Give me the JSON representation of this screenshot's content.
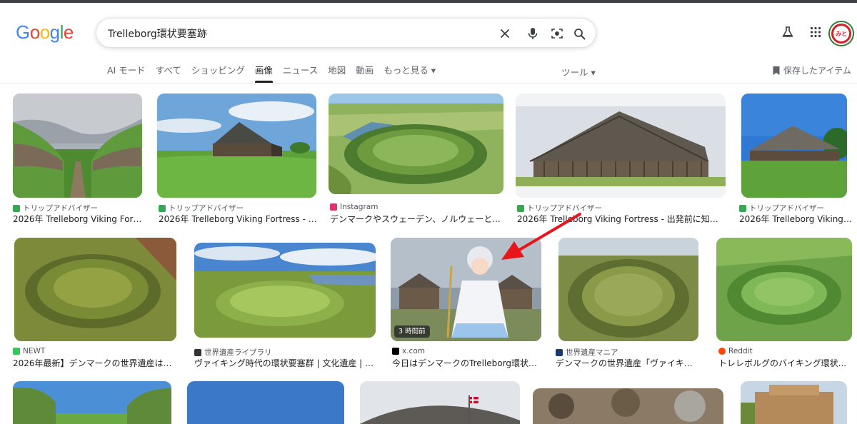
{
  "search": {
    "query": "Trelleborg環状要塞跡"
  },
  "logo": [
    "G",
    "o",
    "o",
    "g",
    "l",
    "e"
  ],
  "logo_colors": [
    "#4285F4",
    "#EA4335",
    "#FBBC05",
    "#4285F4",
    "#34A853",
    "#EA4335"
  ],
  "icons": {
    "clear": "close-icon",
    "voice": "microphone-icon",
    "lens": "camera-lens-icon",
    "search": "search-icon",
    "labs": "flask-icon",
    "apps": "apps-grid-icon",
    "saved": "bookmark-icon"
  },
  "avatar": {
    "text": "みと"
  },
  "tabs": [
    {
      "label": "AI モード",
      "active": false
    },
    {
      "label": "すべて",
      "active": false
    },
    {
      "label": "ショッピング",
      "active": false
    },
    {
      "label": "画像",
      "active": true
    },
    {
      "label": "ニュース",
      "active": false
    },
    {
      "label": "地図",
      "active": false
    },
    {
      "label": "動画",
      "active": false
    },
    {
      "label": "もっと見る ▾",
      "active": false
    }
  ],
  "tools_label": "ツール ▾",
  "saved_label": "保存したアイテム",
  "results_row1": [
    {
      "source": "トリップアドバイザー",
      "title": "2026年 Trelleborg Viking Fortres...",
      "favicon": "#34a853"
    },
    {
      "source": "トリップアドバイザー",
      "title": "2026年 Trelleborg Viking Fortress - 出...",
      "favicon": "#34a853"
    },
    {
      "source": "Instagram",
      "title": "デンマークやスウェーデン、ノルウェーと...",
      "favicon": "#e1306c"
    },
    {
      "source": "トリップアドバイザー",
      "title": "2026年 Trelleborg Viking Fortress - 出発前に知って...",
      "favicon": "#34a853"
    },
    {
      "source": "トリップアドバイザー",
      "title": "2026年 Trelleborg Viking F...",
      "favicon": "#34a853"
    }
  ],
  "results_row2": [
    {
      "source": "NEWT",
      "title": "2026年最新】デンマークの世界遺産は11...",
      "favicon": "#34c759"
    },
    {
      "source": "世界遺産ライブラリ",
      "title": "ヴァイキング時代の環状要塞群 | 文化遺産 | 世...",
      "favicon": "#333333"
    },
    {
      "source": "x.com",
      "title": "今日はデンマークのTrelleborg環状要...",
      "favicon": "#000000"
    },
    {
      "source": "世界遺産マニア",
      "title": "デンマークの世界遺産「ヴァイキン...",
      "favicon": "#1a3a6b"
    },
    {
      "source": "Reddit",
      "title": "トレレボルグのバイキング環状...",
      "favicon": "#ff4500"
    }
  ],
  "time_badge": "3 時間前",
  "annotation_color": "#e8151b"
}
